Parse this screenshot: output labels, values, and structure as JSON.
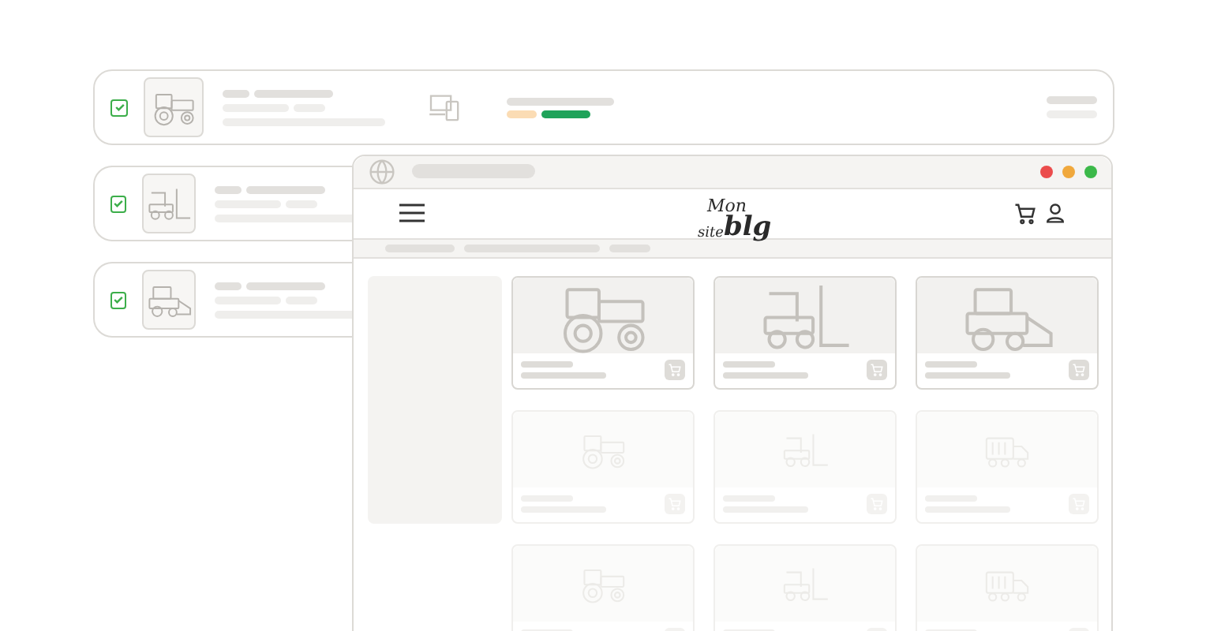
{
  "listing_rows": [
    {
      "checked": true,
      "kind": "tractor",
      "tags": [
        {
          "color": "#fbdcb4"
        },
        {
          "color": "#1fa35a"
        }
      ]
    },
    {
      "checked": true,
      "kind": "forklift"
    },
    {
      "checked": true,
      "kind": "combine"
    }
  ],
  "browser": {
    "logo": {
      "line1": "Mon",
      "line2_small": "site",
      "line2_large": "blg"
    },
    "products": [
      {
        "kind": "tractor",
        "faded": false
      },
      {
        "kind": "forklift",
        "faded": false
      },
      {
        "kind": "combine",
        "faded": false
      },
      {
        "kind": "tractor",
        "faded": true
      },
      {
        "kind": "forklift",
        "faded": true
      },
      {
        "kind": "truck",
        "faded": true
      },
      {
        "kind": "tractor",
        "faded": true
      },
      {
        "kind": "forklift",
        "faded": true
      },
      {
        "kind": "truck",
        "faded": true
      }
    ]
  }
}
